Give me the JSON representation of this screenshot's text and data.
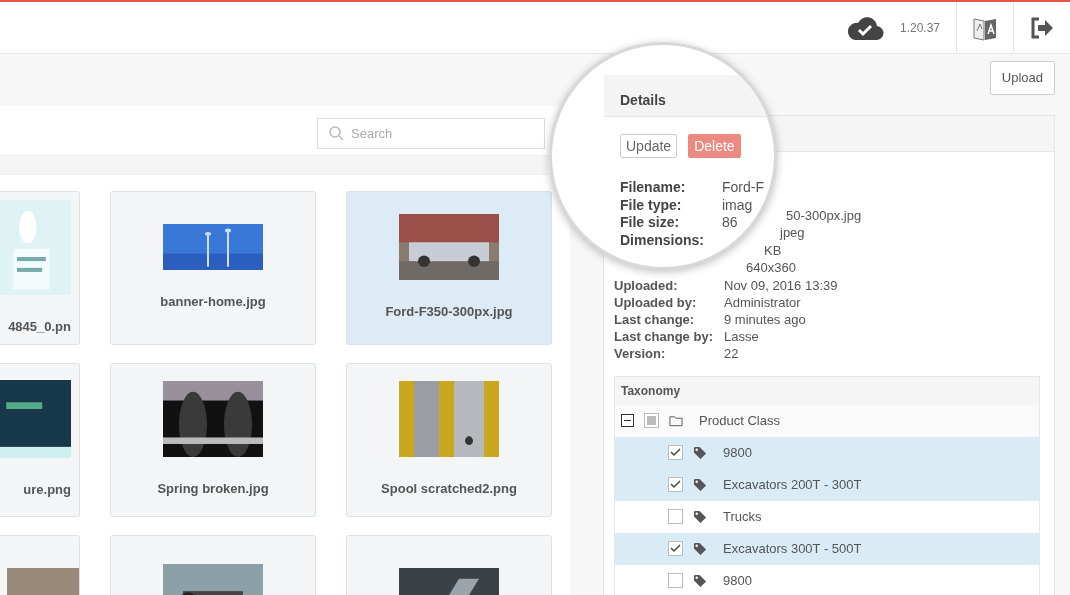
{
  "topbar": {
    "version": "1.20.37"
  },
  "upload_button": "Upload",
  "search": {
    "placeholder": "Search"
  },
  "tiles": [
    {
      "name": "4845_0.pn",
      "selected": false
    },
    {
      "name": "banner-home.jpg",
      "selected": false
    },
    {
      "name": "Ford-F350-300px.jpg",
      "selected": true
    },
    {
      "name": "ure.png",
      "selected": false
    },
    {
      "name": "Spring broken.jpg",
      "selected": false
    },
    {
      "name": "Spool scratched2.png",
      "selected": false
    },
    {
      "selected": false
    },
    {
      "selected": false
    },
    {
      "selected": false
    }
  ],
  "details": {
    "partial_values": [
      "50-300px.jpg",
      "jpeg",
      "KB",
      "640x360"
    ],
    "rows": [
      {
        "label": "Uploaded:",
        "value": "Nov 09, 2016 13:39"
      },
      {
        "label": "Uploaded by:",
        "value": "Administrator"
      },
      {
        "label": "Last change:",
        "value": "9 minutes ago"
      },
      {
        "label": "Last change by:",
        "value": "Lasse"
      },
      {
        "label": "Version:",
        "value": "22"
      }
    ]
  },
  "magnifier": {
    "title": "Details",
    "buttons": [
      {
        "label": "Update",
        "kind": "default"
      },
      {
        "label": "Delete",
        "kind": "danger"
      }
    ],
    "rows": [
      {
        "label": "Filename:",
        "value": "Ford-F"
      },
      {
        "label": "File type:",
        "value": "imag"
      },
      {
        "label": "File size:",
        "value": "86"
      },
      {
        "label": "Dimensions:"
      }
    ]
  },
  "taxonomy": {
    "title": "Taxonomy",
    "tree": [
      {
        "label": "Product Class",
        "expanded": true,
        "checked": false,
        "indeterminate": true,
        "children": [
          {
            "label": "9800",
            "checked": true
          },
          {
            "label": "Excavators 200T - 300T",
            "checked": true
          },
          {
            "label": "Trucks",
            "checked": false
          },
          {
            "label": "Excavators 300T - 500T",
            "checked": true
          },
          {
            "label": "9800",
            "checked": false
          }
        ]
      }
    ]
  }
}
